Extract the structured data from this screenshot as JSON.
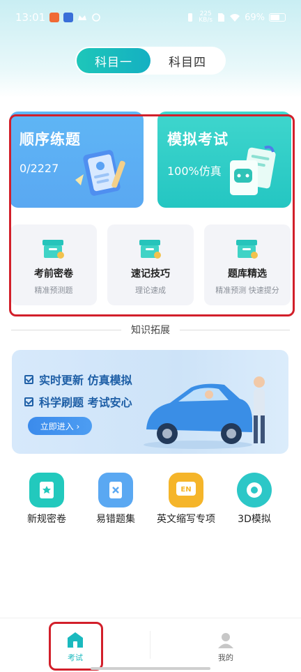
{
  "status_bar": {
    "time": "13:01",
    "net_speed_top": "225",
    "net_speed_unit": "KB/s",
    "battery": "69%"
  },
  "subject_tabs": [
    {
      "label": "科目一",
      "active": true
    },
    {
      "label": "科目四",
      "active": false
    }
  ],
  "practice_card": {
    "title": "顺序练题",
    "progress": "0/2227"
  },
  "mock_card": {
    "title": "模拟考试",
    "subtitle": "100%仿真"
  },
  "tools": [
    {
      "title": "考前密卷",
      "sub": "精准预测题"
    },
    {
      "title": "速记技巧",
      "sub": "理论速成"
    },
    {
      "title": "题库精选",
      "sub": "精准预测 快速提分"
    }
  ],
  "divider_text": "知识拓展",
  "banner": {
    "line1": "实时更新 仿真模拟",
    "line2": "科学刷题 考试安心",
    "button": "立即进入 ›"
  },
  "quick_items": [
    {
      "label": "新规密卷",
      "color": "#22c9bd"
    },
    {
      "label": "易错题集",
      "color": "#5aa8f2"
    },
    {
      "label": "英文缩写专项",
      "color": "#f5b52a",
      "icon_text": "EN"
    },
    {
      "label": "3D模拟",
      "color": "#2cc7c7"
    }
  ],
  "nav": [
    {
      "label": "考试",
      "active": true
    },
    {
      "label": "我的",
      "active": false
    }
  ],
  "colors": {
    "accent": "#1ab9be",
    "highlight": "#d21f2a"
  }
}
